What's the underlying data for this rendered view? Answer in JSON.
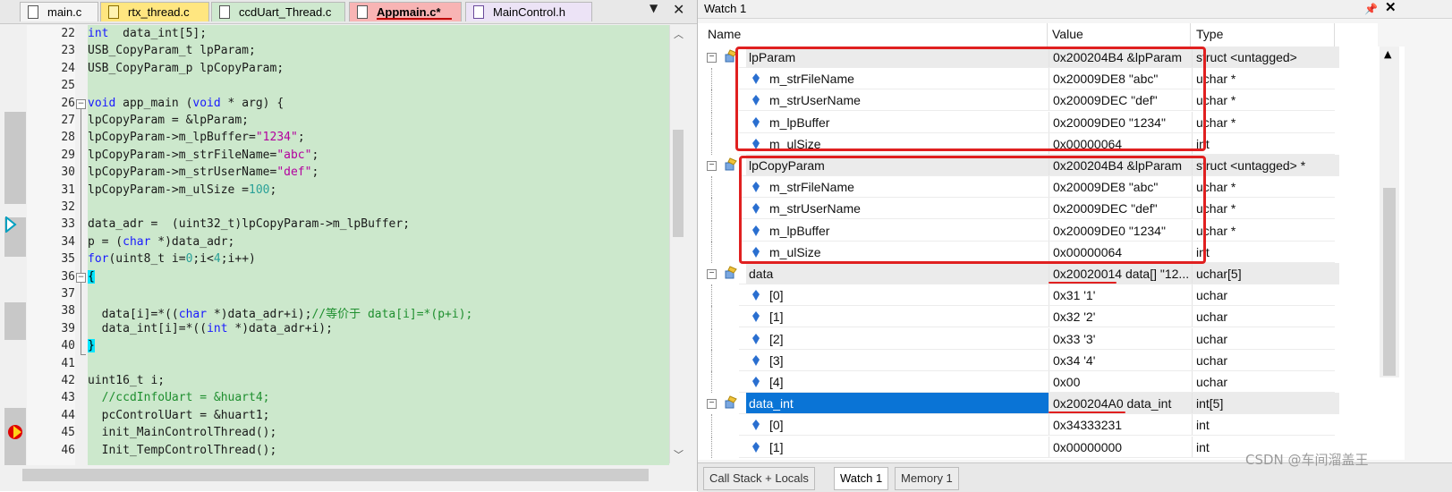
{
  "editor": {
    "tabs": [
      {
        "label": "main.c",
        "active": false
      },
      {
        "label": "rtx_thread.c",
        "active": false
      },
      {
        "label": "ccdUart_Thread.c",
        "active": false
      },
      {
        "label": "Appmain.c*",
        "active": true
      },
      {
        "label": "MainControl.h",
        "active": false
      }
    ],
    "dropdown_icon": "chevron-down-icon",
    "close_icon": "close-icon",
    "line_numbers": [
      "22",
      "23",
      "24",
      "25",
      "26",
      "27",
      "28",
      "29",
      "30",
      "31",
      "32",
      "33",
      "34",
      "35",
      "36",
      "37",
      "38",
      "39",
      "40",
      "41",
      "42",
      "43",
      "44",
      "45",
      "46"
    ],
    "code": [
      {
        "kw": "int",
        "rest": "  data_int[5];"
      },
      {
        "plain": "USB_CopyParam_t lpParam;"
      },
      {
        "plain": "USB_CopyParam_p lpCopyParam;"
      },
      {
        "plain": ""
      },
      {
        "kw": "void",
        "mid": " app_main (",
        "kw2": "void",
        "rest": " * arg) {"
      },
      {
        "plain": "lpCopyParam = &lpParam;"
      },
      {
        "pre": "lpCopyParam->m_lpBuffer=",
        "str": "\"1234\"",
        "post": ";"
      },
      {
        "pre": "lpCopyParam->m_strFileName=",
        "str": "\"abc\"",
        "post": ";"
      },
      {
        "pre": "lpCopyParam->m_strUserName=",
        "str": "\"def\"",
        "post": ";"
      },
      {
        "pre": "lpCopyParam->m_ulSize =",
        "num": "100",
        "post": ";"
      },
      {
        "plain": ""
      },
      {
        "plain": "data_adr =  (uint32_t)lpCopyParam->m_lpBuffer;"
      },
      {
        "pre": "p = (",
        "kw": "char",
        "post": " *)data_adr;"
      },
      {
        "kw": "for",
        "rest": "(uint8_t i=",
        "num": "0",
        "rest2": ";i<",
        "num2": "4",
        "rest3": ";i++)"
      },
      {
        "brace": "{"
      },
      {
        "plain": ""
      },
      {
        "pre": "  data[i]=*((",
        "kw": "char",
        "post": " *)data_adr+i);",
        "cmt": "//等价于 data[i]=*(p+i);"
      },
      {
        "pre": "  data_int[i]=*((",
        "kw": "int",
        "post": " *)data_adr+i);"
      },
      {
        "brace": "}"
      },
      {
        "plain": ""
      },
      {
        "plain": "uint16_t i;"
      },
      {
        "cmt": "  //ccdInfoUart = &huart4;"
      },
      {
        "plain": "  pcControlUart = &huart1;"
      },
      {
        "plain": "  init_MainControlThread();"
      },
      {
        "plain": "  Init_TempControlThread();"
      }
    ],
    "current_line_marker": "arrow-icon",
    "breakpoint_marker": "breakpoint-icon"
  },
  "watch": {
    "title": "Watch 1",
    "pin_icon": "pin-icon",
    "close_icon": "close-icon",
    "columns": {
      "name": "Name",
      "value": "Value",
      "type": "Type"
    },
    "rows": [
      {
        "name": "lpParam",
        "value": "0x200204B4 &lpParam",
        "type": "struct <untagged>",
        "level": 0,
        "parent": true
      },
      {
        "name": "m_strFileName",
        "value": "0x20009DE8 \"abc\"",
        "type": "uchar *",
        "level": 1
      },
      {
        "name": "m_strUserName",
        "value": "0x20009DEC \"def\"",
        "type": "uchar *",
        "level": 1
      },
      {
        "name": "m_lpBuffer",
        "value": "0x20009DE0 \"1234\"",
        "type": "uchar *",
        "level": 1
      },
      {
        "name": "m_ulSize",
        "value": "0x00000064",
        "type": "int",
        "level": 1
      },
      {
        "name": "lpCopyParam",
        "value": "0x200204B4 &lpParam",
        "type": "struct <untagged> *",
        "level": 0,
        "parent": true
      },
      {
        "name": "m_strFileName",
        "value": "0x20009DE8 \"abc\"",
        "type": "uchar *",
        "level": 1
      },
      {
        "name": "m_strUserName",
        "value": "0x20009DEC \"def\"",
        "type": "uchar *",
        "level": 1
      },
      {
        "name": "m_lpBuffer",
        "value": "0x20009DE0 \"1234\"",
        "type": "uchar *",
        "level": 1
      },
      {
        "name": "m_ulSize",
        "value": "0x00000064",
        "type": "int",
        "level": 1
      },
      {
        "name": "data",
        "value": "0x20020014 data[] \"12...",
        "type": "uchar[5]",
        "level": 0,
        "parent": true
      },
      {
        "name": "[0]",
        "value": "0x31 '1'",
        "type": "uchar",
        "level": 1
      },
      {
        "name": "[1]",
        "value": "0x32 '2'",
        "type": "uchar",
        "level": 1
      },
      {
        "name": "[2]",
        "value": "0x33 '3'",
        "type": "uchar",
        "level": 1
      },
      {
        "name": "[3]",
        "value": "0x34 '4'",
        "type": "uchar",
        "level": 1
      },
      {
        "name": "[4]",
        "value": "0x00",
        "type": "uchar",
        "level": 1
      },
      {
        "name": "data_int",
        "value": "0x200204A0 data_int",
        "type": "int[5]",
        "level": 0,
        "parent": true,
        "selected": true
      },
      {
        "name": "[0]",
        "value": "0x34333231",
        "type": "int",
        "level": 1
      },
      {
        "name": "[1]",
        "value": "0x00000000",
        "type": "int",
        "level": 1
      }
    ],
    "bottom_tabs": [
      "Call Stack + Locals",
      "Watch 1",
      "Memory 1"
    ],
    "watermark": "CSDN @车间溜盖王"
  }
}
